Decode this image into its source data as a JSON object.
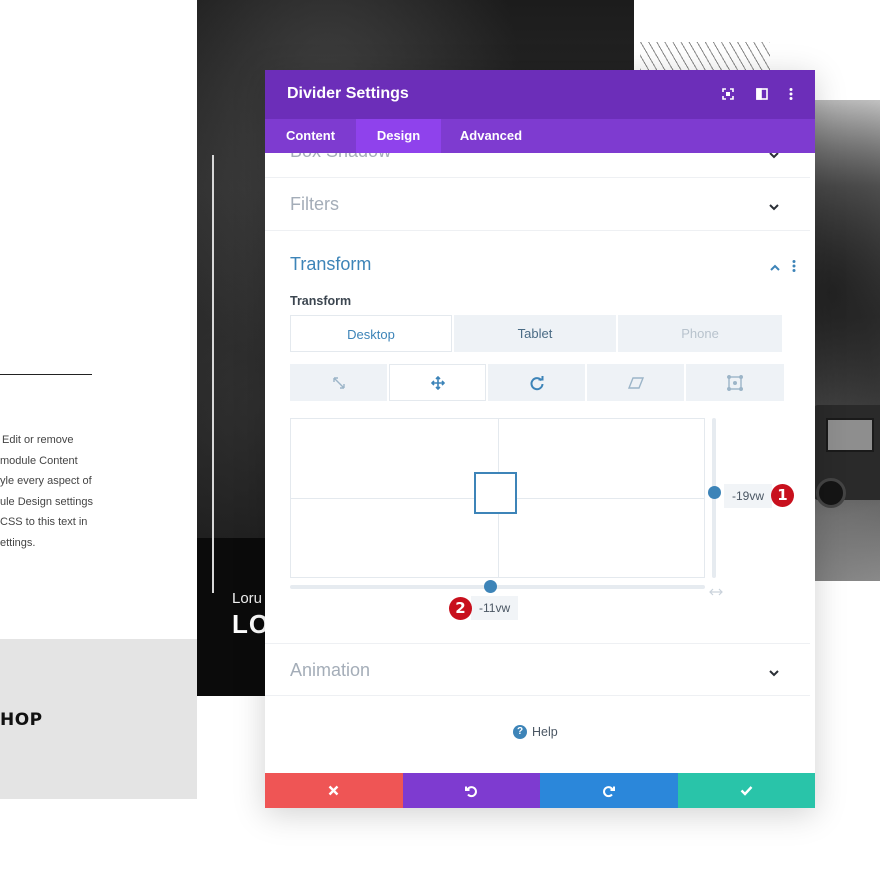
{
  "background": {
    "body_lines": [
      "Edit or remove",
      "module Content",
      "yle every aspect of",
      "ule Design settings",
      "CSS to this text in",
      "ettings."
    ],
    "lorem_small": "Loru",
    "lorem_big": "LO",
    "shop": "HOP"
  },
  "modal": {
    "title": "Divider Settings",
    "header_icons": [
      "expand-icon",
      "sidebar-toggle-icon",
      "more-options-icon"
    ],
    "tabs": [
      {
        "label": "Content",
        "active": false
      },
      {
        "label": "Design",
        "active": true
      },
      {
        "label": "Advanced",
        "active": false
      }
    ],
    "sections": {
      "box_shadow": "Box Shadow",
      "filters": "Filters",
      "animation": "Animation"
    },
    "transform": {
      "title": "Transform",
      "field_label": "Transform",
      "device_tabs": [
        {
          "label": "Desktop",
          "active": true
        },
        {
          "label": "Tablet",
          "active": false
        },
        {
          "label": "Phone",
          "active": false
        }
      ],
      "tools": [
        {
          "name": "scale-icon",
          "active": false
        },
        {
          "name": "translate-icon",
          "active": true
        },
        {
          "name": "rotate-icon",
          "active": false
        },
        {
          "name": "skew-icon",
          "active": false
        },
        {
          "name": "origin-icon",
          "active": false
        }
      ],
      "translate_y": "-19vw",
      "translate_x": "-11vw",
      "badge_y": "1",
      "badge_x": "2"
    },
    "help_label": "Help",
    "footer": [
      {
        "name": "discard-icon",
        "color": "#ef5555"
      },
      {
        "name": "undo-icon",
        "color": "#7e3bd0"
      },
      {
        "name": "redo-icon",
        "color": "#2b87da"
      },
      {
        "name": "save-check-icon",
        "color": "#29c4a9"
      }
    ]
  },
  "colors": {
    "header_purple": "#6c2eb9",
    "tab_bar_purple": "#7e3bd0",
    "active_tab_purple": "#8f42ec",
    "accent_blue": "#3d84b8",
    "badge_red": "#c8101d"
  }
}
